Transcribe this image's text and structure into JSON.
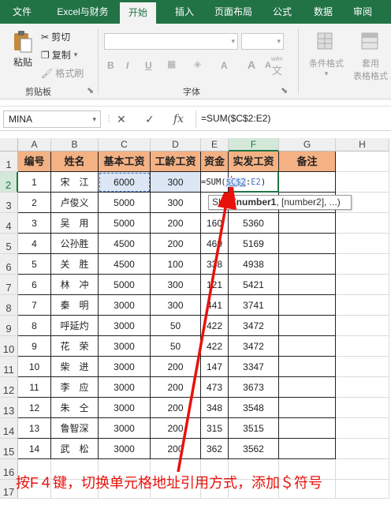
{
  "ribbon_tabs": [
    "文件",
    "Excel与财务",
    "开始",
    "插入",
    "页面布局",
    "公式",
    "数据",
    "审阅"
  ],
  "active_tab": "开始",
  "clipboard": {
    "paste": "粘贴",
    "cut": "剪切",
    "copy": "复制",
    "format_painter": "格式刷",
    "group_label": "剪贴板"
  },
  "font": {
    "group_label": "字体",
    "bold": "B",
    "italic": "I",
    "underline": "U",
    "size_up": "A",
    "size_down": "A",
    "wen": "wén",
    "wen_char": "文"
  },
  "styles": {
    "conditional_format": "条件格式",
    "table_format_line1": "套用",
    "table_format_line2": "表格格式"
  },
  "formula_bar": {
    "name_box": "MINA",
    "cancel": "✕",
    "enter": "✓",
    "fx": "fx",
    "formula": "=SUM($C$2:E2)"
  },
  "columns": [
    "A",
    "B",
    "C",
    "D",
    "E",
    "F",
    "G",
    "H"
  ],
  "rows": [
    "1",
    "2",
    "3",
    "4",
    "5",
    "6",
    "7",
    "8",
    "9",
    "10",
    "11",
    "12",
    "13",
    "14",
    "15",
    "16",
    "17"
  ],
  "header_row": [
    "编号",
    "姓名",
    "基本工资",
    "工龄工资",
    "资金",
    "实发工资",
    "备注"
  ],
  "data_rows": [
    [
      "1",
      "宋　江",
      "6000",
      "300",
      "",
      "",
      ""
    ],
    [
      "2",
      "卢俊义",
      "5000",
      "300",
      "",
      "",
      ""
    ],
    [
      "3",
      "吴　用",
      "5000",
      "200",
      "160",
      "5360",
      ""
    ],
    [
      "4",
      "公孙胜",
      "4500",
      "200",
      "469",
      "5169",
      ""
    ],
    [
      "5",
      "关　胜",
      "4500",
      "100",
      "338",
      "4938",
      ""
    ],
    [
      "6",
      "林　冲",
      "5000",
      "300",
      "121",
      "5421",
      ""
    ],
    [
      "7",
      "秦　明",
      "3000",
      "300",
      "441",
      "3741",
      ""
    ],
    [
      "8",
      "呼延灼",
      "3000",
      "50",
      "422",
      "3472",
      ""
    ],
    [
      "9",
      "花　荣",
      "3000",
      "50",
      "422",
      "3472",
      ""
    ],
    [
      "10",
      "柴　进",
      "3000",
      "200",
      "147",
      "3347",
      ""
    ],
    [
      "11",
      "李　应",
      "3000",
      "200",
      "473",
      "3673",
      ""
    ],
    [
      "12",
      "朱　仝",
      "3000",
      "200",
      "348",
      "3548",
      ""
    ],
    [
      "13",
      "鲁智深",
      "3000",
      "200",
      "315",
      "3515",
      ""
    ],
    [
      "14",
      "武　松",
      "3000",
      "200",
      "362",
      "3562",
      ""
    ]
  ],
  "edit_cell": {
    "prefix": "=SUM(",
    "ref_abs": "$C$2",
    "sep": ":",
    "ref_rel": "E2",
    "suffix": ")"
  },
  "tooltip": {
    "fn": "SUM",
    "arg1": "number1",
    "rest": ", [number2], ...)"
  },
  "caption": "按F４键，切换单元格地址引用方式，添加＄符号",
  "colors": {
    "ribbon_green": "#217346",
    "header_fill": "#f4b183",
    "arrow_red": "#e8120c",
    "ref_blue": "#4472c4"
  }
}
